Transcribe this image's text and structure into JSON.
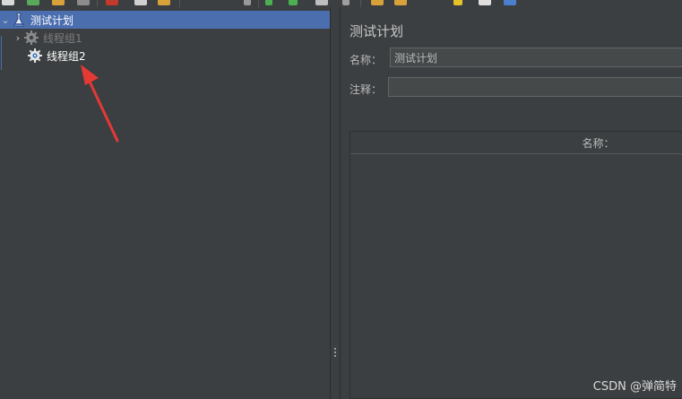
{
  "tree": {
    "items": [
      {
        "label": "测试计划",
        "icon": "test-plan-icon",
        "state": "selected",
        "expanded": true
      },
      {
        "label": "线程组1",
        "icon": "gear-icon",
        "state": "disabled",
        "expanded": false
      },
      {
        "label": "线程组2",
        "icon": "gear-icon",
        "state": "normal"
      }
    ]
  },
  "panel": {
    "title": "测试计划",
    "name_label": "名称：",
    "name_value": "测试计划",
    "comment_label": "注释：",
    "comment_value": "",
    "table": {
      "columns": [
        "名称："
      ]
    }
  },
  "watermark": "CSDN @弹简特",
  "colors": {
    "background": "#3c3f41",
    "selection": "#4b6eaf",
    "annotation_arrow": "#e53935"
  }
}
